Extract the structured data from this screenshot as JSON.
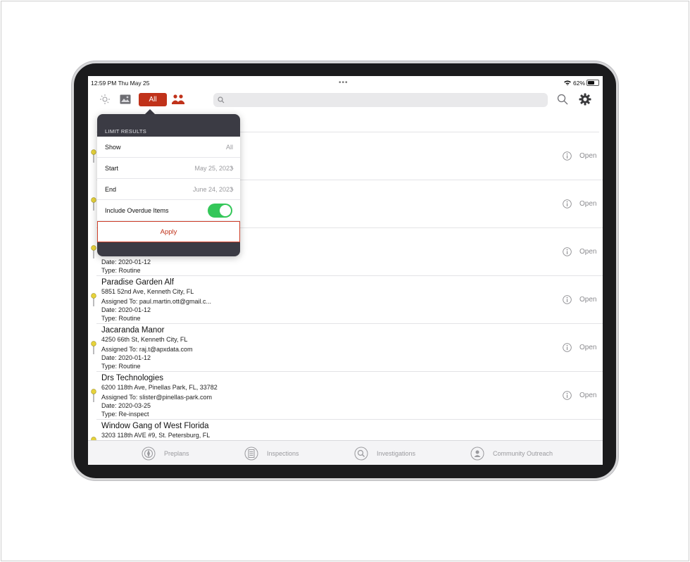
{
  "status_bar": {
    "time": "12:59 PM  Thu May 25",
    "battery": "62%",
    "battery_level": 0.62
  },
  "toolbar": {
    "filter_label": "All",
    "search_placeholder": ""
  },
  "popover": {
    "title": "LIMIT RESULTS",
    "rows": [
      {
        "label": "Show",
        "value": "All"
      },
      {
        "label": "Start",
        "value": "May 25, 2023"
      },
      {
        "label": "End",
        "value": "June 24, 2023"
      },
      {
        "label": "Include Overdue Items",
        "value": ""
      }
    ],
    "overdue_on": true,
    "apply_label": "Apply"
  },
  "rows": [
    {
      "name": "",
      "address": "",
      "assigned": "",
      "date": "",
      "type": "",
      "status": "Open"
    },
    {
      "name": "",
      "address": "",
      "assigned": "",
      "date": "",
      "type": "",
      "status": "Open"
    },
    {
      "name": "",
      "address": "",
      "assigned": "",
      "date": "Date: 2020-01-12",
      "type": "Type: Routine",
      "status": "Open"
    },
    {
      "name": "Paradise Garden Alf",
      "address": "5851 52nd Ave, Kenneth City, FL",
      "assigned": "Assigned To: paul.martin.ott@gmail.c...",
      "date": "Date: 2020-01-12",
      "type": "Type: Routine",
      "status": "Open"
    },
    {
      "name": "Jacaranda Manor",
      "address": "4250 66th St, Kenneth City, FL",
      "assigned": "Assigned To: raj.t@apxdata.com",
      "date": "Date: 2020-01-12",
      "type": "Type: Routine",
      "status": "Open"
    },
    {
      "name": "Drs Technologies",
      "address": "6200 118th Ave, Pinellas Park, FL, 33782",
      "assigned": "Assigned To: slister@pinellas-park.com",
      "date": "Date: 2020-03-25",
      "type": "Type: Re-inspect",
      "status": "Open"
    },
    {
      "name": "Window Gang of West Florida",
      "address": "3203  118th AVE #9, St. Petersburg, FL",
      "assigned": "",
      "date": "",
      "type": "",
      "status": ""
    }
  ],
  "tabs": [
    {
      "label": "Preplans",
      "icon": "preplans-icon"
    },
    {
      "label": "Inspections",
      "icon": "inspections-icon"
    },
    {
      "label": "Investigations",
      "icon": "investigations-icon"
    },
    {
      "label": "Community Outreach",
      "icon": "community-outreach-icon"
    }
  ],
  "colors": {
    "accent": "#c0321a",
    "toggle_on": "#34c759",
    "popover_header": "#3b3b44",
    "pin": "#e6d23a"
  }
}
